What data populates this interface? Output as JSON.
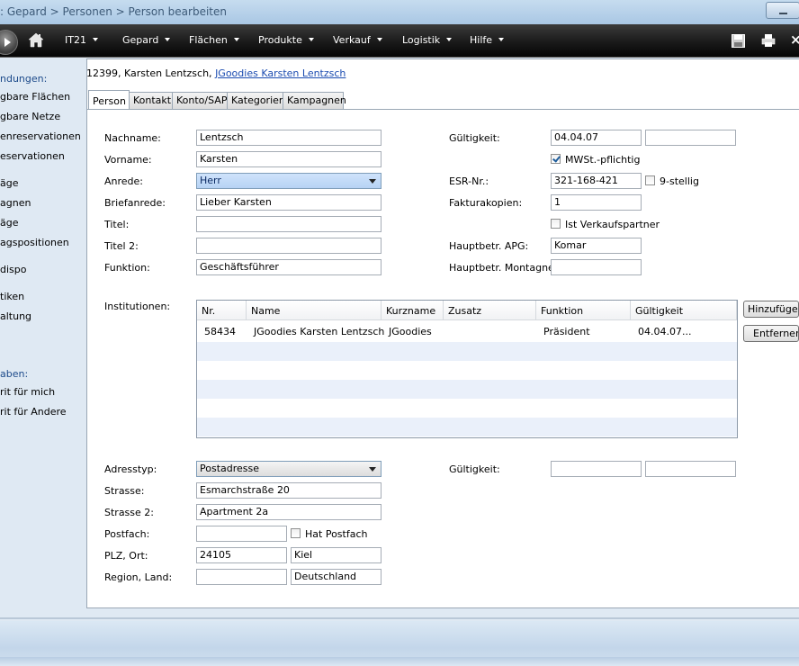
{
  "window": {
    "title": ": Gepard > Personen > Person bearbeiten"
  },
  "menu": [
    {
      "label": "IT21"
    },
    {
      "label": "Gepard"
    },
    {
      "label": "Flächen"
    },
    {
      "label": "Produkte"
    },
    {
      "label": "Verkauf"
    },
    {
      "label": "Logistik"
    },
    {
      "label": "Hilfe"
    }
  ],
  "sidebar": {
    "group1_title": "ndungen:",
    "group1": [
      "gbare Flächen",
      "gbare Netze",
      "enreservationen",
      "eservationen"
    ],
    "group2": [
      "äge",
      "agnen",
      "äge",
      "agspositionen"
    ],
    "group3": [
      "dispo"
    ],
    "group4": [
      "tiken",
      "altung"
    ],
    "group5_title": "aben:",
    "group5": [
      "rit für mich",
      "rit für Andere"
    ]
  },
  "breadcrumb": {
    "prefix": "12399, Karsten Lentzsch, ",
    "link": "JGoodies Karsten Lentzsch"
  },
  "tabs": [
    "Person",
    "Kontakt",
    "Konto/SAP",
    "Kategorien",
    "Kampagnen"
  ],
  "form": {
    "nachname": {
      "label": "Nachname:",
      "value": "Lentzsch"
    },
    "vorname": {
      "label": "Vorname:",
      "value": "Karsten"
    },
    "anrede": {
      "label": "Anrede:",
      "value": "Herr"
    },
    "briefanrede": {
      "label": "Briefanrede:",
      "value": "Lieber Karsten"
    },
    "titel": {
      "label": "Titel:",
      "value": ""
    },
    "titel2": {
      "label": "Titel 2:",
      "value": ""
    },
    "funktion": {
      "label": "Funktion:",
      "value": "Geschäftsführer"
    },
    "gueltigkeit": {
      "label": "Gültigkeit:",
      "from": "04.04.07",
      "to": ""
    },
    "mwst": {
      "label": "MWSt.-pflichtig",
      "checked": true
    },
    "esr": {
      "label": "ESR-Nr.:",
      "value": "321-168-421"
    },
    "neunstellig": {
      "label": "9-stellig",
      "checked": false
    },
    "fakturakopien": {
      "label": "Fakturakopien:",
      "value": "1"
    },
    "verkaufspartner": {
      "label": "Ist Verkaufspartner",
      "checked": false
    },
    "hauptbetr_apg": {
      "label": "Hauptbetr. APG:",
      "value": "Komar"
    },
    "hauptbetr_montage": {
      "label": "Hauptbetr. Montagne:",
      "value": ""
    }
  },
  "institutionen": {
    "label": "Institutionen:",
    "columns": [
      "Nr.",
      "Name",
      "Kurzname",
      "Zusatz",
      "Funktion",
      "Gültigkeit"
    ],
    "rows": [
      [
        "58434",
        "JGoodies Karsten Lentzsch",
        "JGoodies",
        "",
        "Präsident",
        "04.04.07..."
      ]
    ],
    "add_button": "Hinzufügen...",
    "remove_button": "Entfernen"
  },
  "adresse": {
    "adresstyp": {
      "label": "Adresstyp:",
      "value": "Postadresse"
    },
    "gueltigkeit": {
      "label": "Gültigkeit:",
      "from": "",
      "to": ""
    },
    "strasse": {
      "label": "Strasse:",
      "value": "Esmarchstraße 20"
    },
    "strasse2": {
      "label": "Strasse 2:",
      "value": "Apartment 2a"
    },
    "postfach": {
      "label": "Postfach:",
      "value": ""
    },
    "hat_postfach": {
      "label": "Hat Postfach",
      "checked": false
    },
    "plz_ort": {
      "label": "PLZ, Ort:",
      "plz": "24105",
      "ort": "Kiel"
    },
    "region_land": {
      "label": "Region, Land:",
      "region": "",
      "land": "Deutschland"
    }
  }
}
